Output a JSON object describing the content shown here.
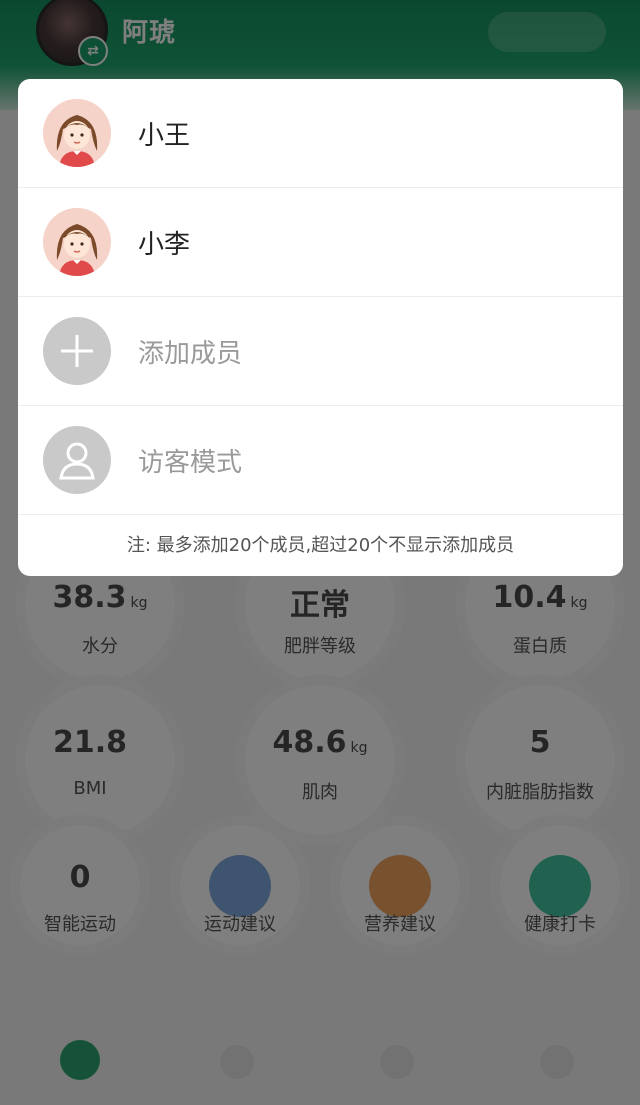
{
  "header": {
    "user_name": "阿琥",
    "switch_icon": "⇄"
  },
  "popup": {
    "members": [
      {
        "name": "小王",
        "icon": "girl-avatar-icon"
      },
      {
        "name": "小李",
        "icon": "girl-avatar-icon"
      }
    ],
    "add_member": "添加成员",
    "guest_mode": "访客模式",
    "note": "注: 最多添加20个成员,超过20个不显示添加成员"
  },
  "dashboard": {
    "metrics": [
      {
        "value": "38.3",
        "unit": "kg",
        "label": "水分"
      },
      {
        "value": "正常",
        "unit": "",
        "label": "肥胖等级"
      },
      {
        "value": "10.4",
        "unit": "kg",
        "label": "蛋白质"
      },
      {
        "value": "21.8",
        "unit": "",
        "label": "BMI"
      },
      {
        "value": "48.6",
        "unit": "kg",
        "label": "肌肉"
      },
      {
        "value": "5",
        "unit": "",
        "label": "内脏脂肪指数"
      }
    ],
    "actions": [
      {
        "value": "0",
        "label": "智能运动"
      },
      {
        "label": "运动建议"
      },
      {
        "label": "营养建议"
      },
      {
        "label": "健康打卡"
      }
    ],
    "colors": {
      "blue": "#7fa9df",
      "orange": "#f0a35e",
      "teal": "#43c3a0",
      "green": "#2aa56f"
    }
  }
}
